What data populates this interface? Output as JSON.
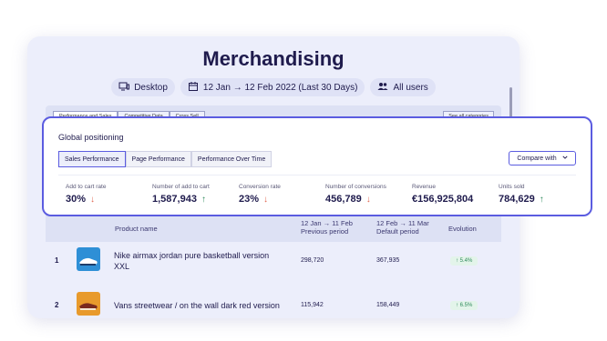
{
  "page": {
    "title": "Merchandising"
  },
  "filters": {
    "device": "Desktop",
    "date_range": "12 Jan → 12 Feb 2022 (Last 30 Days)",
    "users": "All users"
  },
  "background_tabs": [
    "Performance and Sales",
    "Competitive Data",
    "Cross Sell"
  ],
  "see_all": "See all categories",
  "global_positioning": {
    "title": "Global positioning",
    "tabs": [
      "Sales Performance",
      "Page Performance",
      "Performance Over Time"
    ],
    "compare_label": "Compare with",
    "metrics": [
      {
        "label": "Add to cart rate",
        "value": "30%",
        "trend": "down"
      },
      {
        "label": "Number of add to cart",
        "value": "1,587,943",
        "trend": "up"
      },
      {
        "label": "Conversion rate",
        "value": "23%",
        "trend": "down"
      },
      {
        "label": "Number of conversions",
        "value": "456,789",
        "trend": "down"
      },
      {
        "label": "Revenue",
        "value": "€156,925,804",
        "trend": "none"
      },
      {
        "label": "Units sold",
        "value": "784,629",
        "trend": "up"
      }
    ]
  },
  "table": {
    "headers": {
      "product": "Product name",
      "previous_line1": "12 Jan → 11 Feb",
      "previous_line2": "Previous period",
      "default_line1": "12 Feb → 11 Mar",
      "default_line2": "Default period",
      "evolution": "Evolution"
    },
    "rows": [
      {
        "rank": "1",
        "name_line1": "Nike airmax jordan pure basketball version",
        "name_line2": "XXL",
        "previous": "298,720",
        "default": "367,935",
        "evolution": "↑ 5.4%"
      },
      {
        "rank": "2",
        "name_line1": "Vans streetwear / on the wall dark red version",
        "name_line2": "",
        "previous": "115,942",
        "default": "158,449",
        "evolution": "↑ 6.5%"
      }
    ]
  },
  "colors": {
    "accent": "#5b5ce0",
    "down": "#e0654f",
    "up": "#2f8a5c",
    "card_bg": "#eceefb"
  }
}
